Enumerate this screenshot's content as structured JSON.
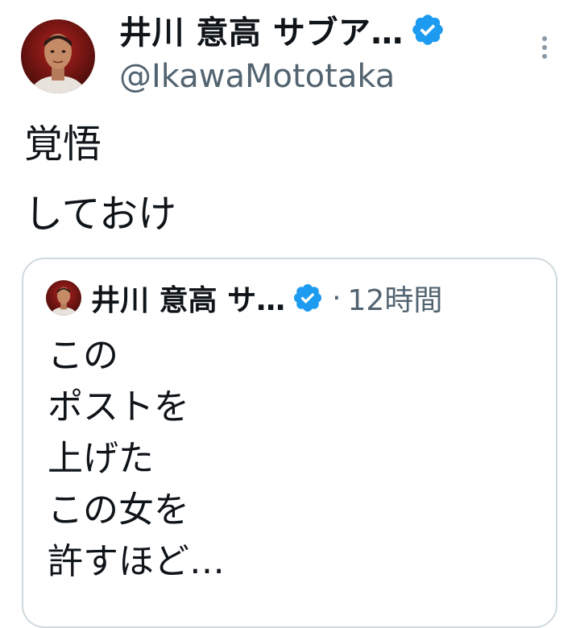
{
  "author": {
    "display_name": "井川 意高 サブア…",
    "handle": "@IkawaMototaka",
    "avatar_icon": "profile-photo",
    "verified_icon": "verified-badge-icon",
    "verified_color": "#1d9bf0"
  },
  "tweet": {
    "lines": [
      "覚悟",
      "しておけ"
    ]
  },
  "quoted_tweet": {
    "display_name": "井川 意高 サ…",
    "separator": "·",
    "timestamp": "12時間",
    "lines": [
      "この",
      "ポストを",
      "上げた",
      "この女を",
      "許すほど…"
    ]
  },
  "menu": {
    "more_icon": "more-vertical-icon"
  }
}
